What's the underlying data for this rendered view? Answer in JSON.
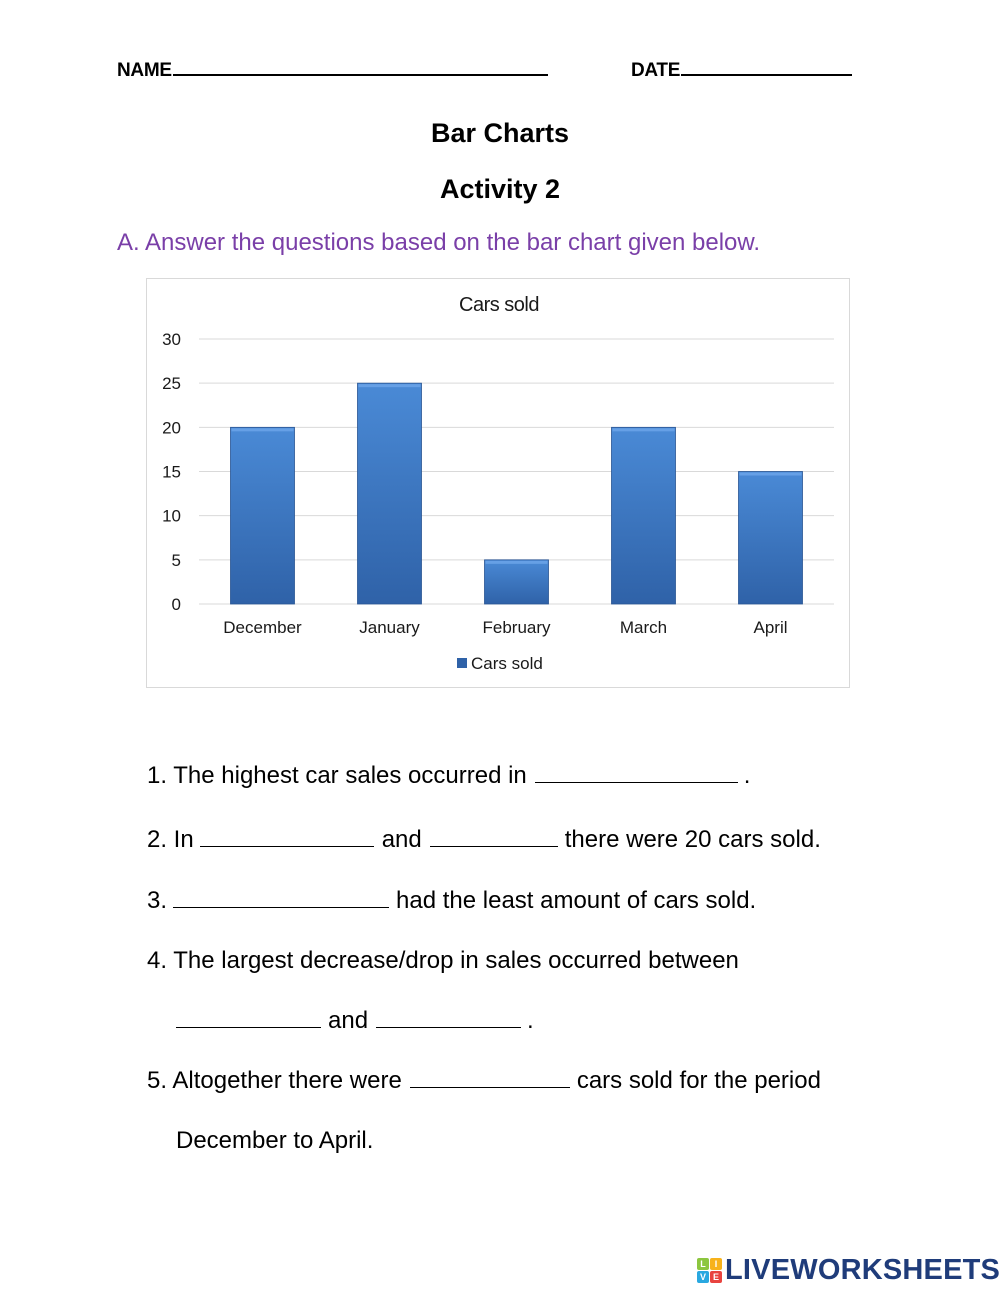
{
  "header": {
    "name_label": "NAME",
    "date_label": "DATE"
  },
  "title": "Bar Charts",
  "subtitle": "Activity 2",
  "instruction": "A. Answer the questions based on the bar chart given below.",
  "colors": {
    "instruction": "#7a3fa8",
    "bar_top": "#4a8ad6",
    "bar_bottom": "#2f62a8",
    "gridline": "#d9d9d9",
    "logo_text": "#1f3c7a"
  },
  "chart_data": {
    "type": "bar",
    "title": "Cars sold",
    "categories": [
      "December",
      "January",
      "February",
      "March",
      "April"
    ],
    "series": [
      {
        "name": "Cars sold",
        "values": [
          20,
          25,
          5,
          20,
          15
        ]
      }
    ],
    "xlabel": "",
    "ylabel": "",
    "ylim": [
      0,
      30
    ],
    "yticks": [
      0,
      5,
      10,
      15,
      20,
      25,
      30
    ],
    "grid": true,
    "legend": "bottom"
  },
  "questions": {
    "q1": {
      "prefix": "1. The highest car sales occurred in",
      "suffix": "."
    },
    "q2": {
      "prefix": "2. In",
      "middle": "and",
      "suffix": "there were 20 cars sold."
    },
    "q3": {
      "prefix": "3.",
      "suffix": "had the least amount of cars sold."
    },
    "q4": {
      "line1": "4. The largest decrease/drop in sales occurred between",
      "middle": "and",
      "suffix": "."
    },
    "q5": {
      "prefix": "5. Altogether there were",
      "suffix": "cars sold for the period",
      "line2": "December to April."
    }
  },
  "logo": {
    "cells": [
      {
        "letter": "L",
        "color": "#8cc63f"
      },
      {
        "letter": "I",
        "color": "#f7b21b"
      },
      {
        "letter": "V",
        "color": "#29a8e0"
      },
      {
        "letter": "E",
        "color": "#e8433f"
      }
    ],
    "text": "LIVEWORKSHEETS"
  }
}
